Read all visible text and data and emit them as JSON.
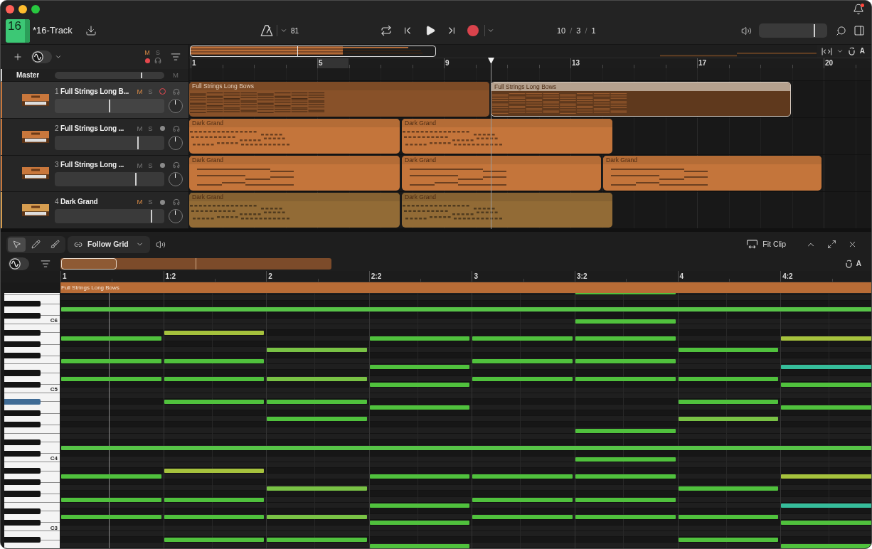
{
  "project": {
    "badge": "16",
    "title": "*16-Track"
  },
  "notifications": {
    "unread": true
  },
  "transport": {
    "tempo": "81",
    "position": [
      {
        "kind": "value",
        "text": "10"
      },
      {
        "kind": "separator",
        "text": "/"
      },
      {
        "kind": "value",
        "text": "3"
      },
      {
        "kind": "separator",
        "text": "/"
      },
      {
        "kind": "value",
        "text": "1"
      }
    ]
  },
  "output_volume": {
    "level": 0.81
  },
  "arrange": {
    "waveform_toggle": {
      "on": false
    },
    "mute": {
      "label": "M",
      "on": true
    },
    "solo": {
      "label": "S",
      "on": false
    },
    "follow_label": "A",
    "ruler": [
      "1",
      "5",
      "9",
      "13",
      "17",
      "20"
    ],
    "master": {
      "name": "Master",
      "volume": {
        "level": 0.79
      },
      "mute": {
        "label": "M",
        "on": false
      }
    },
    "tracks": [
      {
        "number": "1",
        "name": "Full Strings Long B...",
        "color": "#c8773c",
        "selected": true,
        "mute": {
          "label": "M",
          "on": true
        },
        "solo": {
          "label": "S",
          "on": false
        },
        "armed": true,
        "volume": {
          "level": 0.5
        },
        "pan": {
          "level": 0.5
        },
        "clips": [
          {
            "name": "Full Strings Long Bows",
            "kind": "dense",
            "selected": false
          },
          {
            "name": "Full Strings Long Bows",
            "kind": "dense",
            "selected": true
          }
        ]
      },
      {
        "number": "2",
        "name": "Full Strings Long ...",
        "color": "#c8773c",
        "selected": false,
        "mute": {
          "label": "M",
          "on": false
        },
        "solo": {
          "label": "S",
          "on": false
        },
        "armed": false,
        "volume": {
          "level": 0.76
        },
        "pan": {
          "level": 0.5
        },
        "clips": [
          {
            "name": "Dark Grand",
            "kind": "dashed",
            "selected": false
          },
          {
            "name": "Dark Grand",
            "kind": "dashed",
            "selected": false
          }
        ]
      },
      {
        "number": "3",
        "name": "Full Strings Long ...",
        "color": "#c8773c",
        "selected": false,
        "mute": {
          "label": "M",
          "on": false
        },
        "solo": {
          "label": "S",
          "on": false
        },
        "armed": false,
        "volume": {
          "level": 0.74
        },
        "pan": {
          "level": 0.5
        },
        "clips": [
          {
            "name": "Dark Grand",
            "kind": "sustained",
            "selected": false
          },
          {
            "name": "Dark Grand",
            "kind": "sustained",
            "selected": false
          },
          {
            "name": "Dark Grand",
            "kind": "sustained",
            "selected": false
          }
        ]
      },
      {
        "number": "4",
        "name": "Dark Grand",
        "color": "#d69d50",
        "selected": false,
        "mute": {
          "label": "M",
          "on": true
        },
        "solo": {
          "label": "S",
          "on": false
        },
        "armed": false,
        "volume": {
          "level": 0.88
        },
        "pan": {
          "level": 0.5
        },
        "clips": [
          {
            "name": "Dark Grand",
            "kind": "dashed",
            "selected": false
          },
          {
            "name": "Dark Grand",
            "kind": "dashed",
            "selected": false
          }
        ]
      }
    ]
  },
  "editor": {
    "tools": [
      {
        "kind": "pointer",
        "selected": true
      },
      {
        "kind": "pencil",
        "selected": false
      },
      {
        "kind": "brush",
        "selected": false
      }
    ],
    "snap": {
      "label": "Follow Grid"
    },
    "fit_label": "Fit Clip",
    "waveform_toggle": {
      "on": false
    },
    "follow_label": "A",
    "ruler": [
      "1",
      "1:2",
      "2",
      "2:2",
      "3",
      "3:2",
      "4",
      "4:2"
    ],
    "clip_name": "Full Strings Long Bows",
    "keyboard": [
      {
        "label": "C6",
        "pressed": false
      },
      {
        "label": "C5",
        "pressed": true
      },
      {
        "label": "C4",
        "pressed": false
      },
      {
        "label": "C3",
        "pressed": false
      }
    ]
  }
}
